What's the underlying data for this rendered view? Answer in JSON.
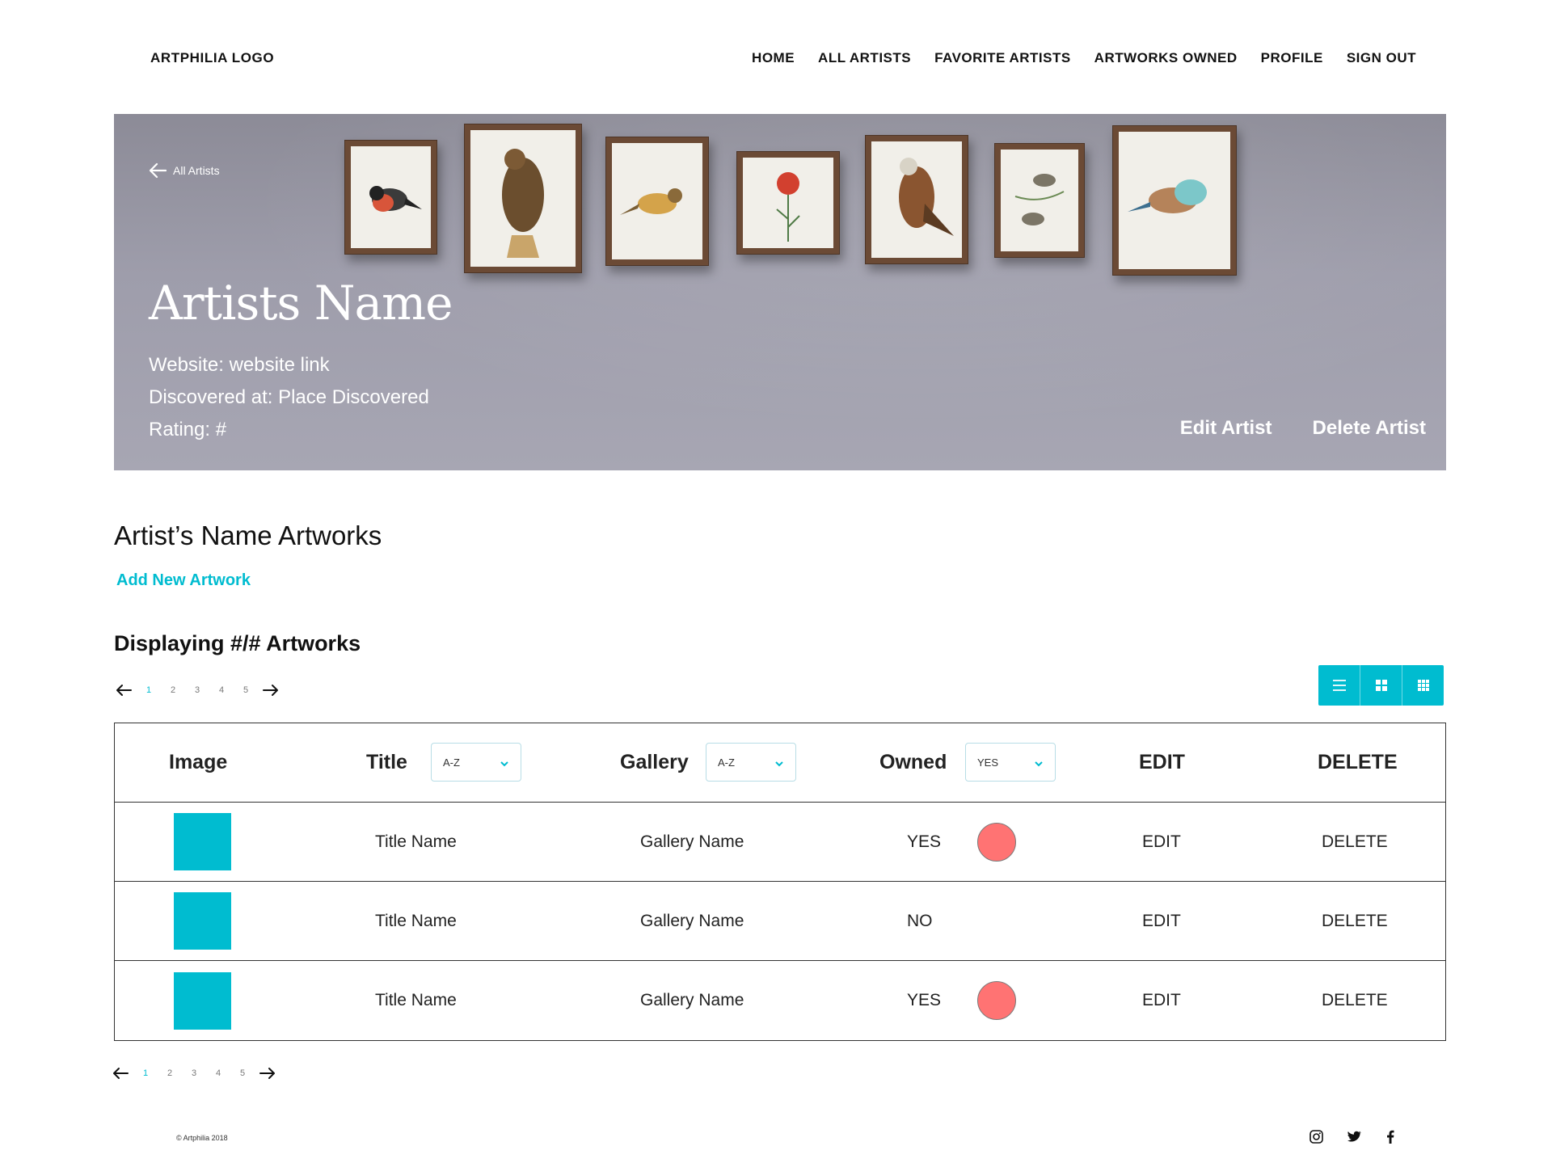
{
  "header": {
    "logo": "ARTPHILIA LOGO",
    "nav": [
      "HOME",
      "ALL ARTISTS",
      "FAVORITE ARTISTS",
      "ARTWORKS OWNED",
      "PROFILE",
      "SIGN OUT"
    ]
  },
  "hero": {
    "back_label": "All Artists",
    "artist_name": "Artists Name",
    "website": "Website: website link",
    "discovered": "Discovered at: Place Discovered",
    "rating": "Rating: #",
    "edit_label": "Edit Artist",
    "delete_label": "Delete Artist"
  },
  "section": {
    "title": "Artist’s Name Artworks",
    "add_label": "Add New Artwork",
    "displaying": "Displaying #/# Artworks"
  },
  "pagination": {
    "pages": [
      "1",
      "2",
      "3",
      "4",
      "5"
    ],
    "active": "1"
  },
  "table": {
    "headers": {
      "image": "Image",
      "title": "Title",
      "gallery": "Gallery",
      "owned": "Owned",
      "edit": "EDIT",
      "delete": "DELETE"
    },
    "filters": {
      "title": "A-Z",
      "gallery": "A-Z",
      "owned": "YES"
    },
    "rows": [
      {
        "title": "Title Name",
        "gallery": "Gallery Name",
        "owned": "YES",
        "edit": "EDIT",
        "delete": "DELETE"
      },
      {
        "title": "Title Name",
        "gallery": "Gallery Name",
        "owned": "NO",
        "edit": "EDIT",
        "delete": "DELETE"
      },
      {
        "title": "Title Name",
        "gallery": "Gallery Name",
        "owned": "YES",
        "edit": "EDIT",
        "delete": "DELETE"
      }
    ]
  },
  "footer": {
    "copyright": "© Artphilia 2018",
    "social_icons": [
      "instagram-icon",
      "twitter-icon",
      "facebook-icon"
    ]
  },
  "colors": {
    "accent": "#00bcd0",
    "owned_dot": "#ff7373",
    "hero_wall": "#9e9dab"
  }
}
